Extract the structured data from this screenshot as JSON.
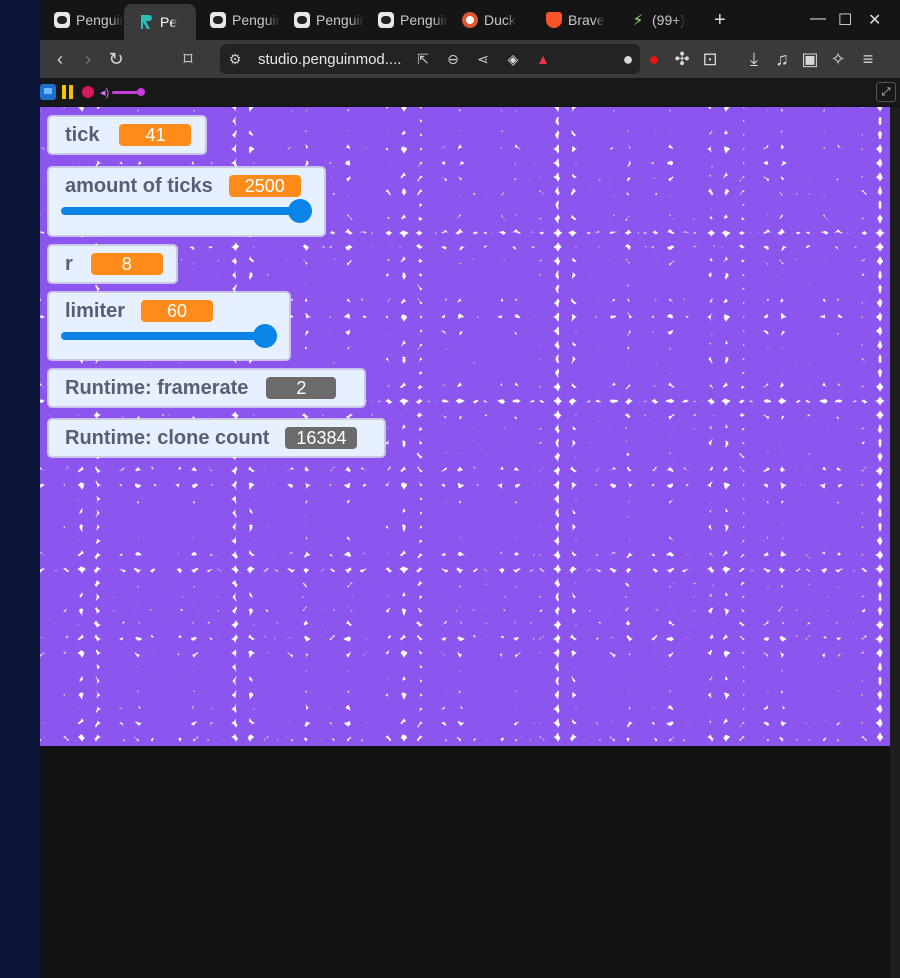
{
  "tabs": [
    {
      "title": "Penguin",
      "icon": "penguin-icon",
      "active": false
    },
    {
      "title": "Pe",
      "icon": "penguinmod-studio-icon",
      "active": true
    },
    {
      "title": "Penguin",
      "icon": "penguin-icon",
      "active": false
    },
    {
      "title": "Penguin",
      "icon": "penguin-icon",
      "active": false
    },
    {
      "title": "Penguin",
      "icon": "penguin-icon",
      "active": false
    },
    {
      "title": "Duck",
      "icon": "duckduckgo-icon",
      "active": false
    },
    {
      "title": "Brave",
      "icon": "brave-icon",
      "active": false
    },
    {
      "title": "(99+)",
      "icon": "bolt-icon",
      "active": false
    }
  ],
  "address_bar": {
    "url": "studio.penguinmod...."
  },
  "monitors": {
    "tick": {
      "label": "tick",
      "value": "41"
    },
    "amount_of_ticks": {
      "label": "amount of ticks",
      "value": "2500",
      "slider_level": 1.0
    },
    "r": {
      "label": "r",
      "value": "8"
    },
    "limiter": {
      "label": "limiter",
      "value": "60",
      "slider_level": 1.0
    },
    "framerate": {
      "label": "Runtime: framerate",
      "value": "2"
    },
    "clone_count": {
      "label": "Runtime: clone count",
      "value": "16384"
    }
  },
  "colors": {
    "sprite_fill": "#8b55ee",
    "variable_value_bg": "#ff8c1a",
    "runtime_value_bg": "#6b6b6b",
    "slider": "#0b84e8"
  }
}
